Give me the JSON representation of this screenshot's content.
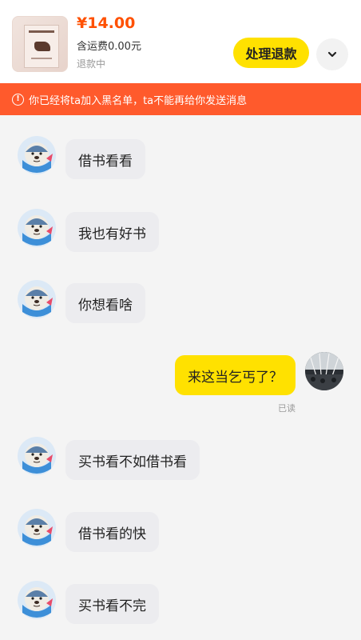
{
  "order": {
    "price": "¥14.00",
    "shipping": "含运费0.00元",
    "status": "退款中",
    "refund_button": "处理退款"
  },
  "banner": {
    "icon": "!",
    "text": "你已经将ta加入黑名单，ta不能再给你发送消息"
  },
  "messages": [
    {
      "side": "received",
      "text": "借书看看"
    },
    {
      "side": "received",
      "text": "我也有好书"
    },
    {
      "side": "received",
      "text": "你想看啥"
    },
    {
      "side": "sent",
      "text": "来这当乞丐了？",
      "status": "已读"
    },
    {
      "side": "received",
      "text": "买书看不如借书看"
    },
    {
      "side": "received",
      "text": "借书看的快"
    },
    {
      "side": "received",
      "text": "买书看不完"
    }
  ],
  "colors": {
    "accent_yellow": "#ffe100",
    "price_orange": "#ff5000",
    "banner_orange": "#ff5a2c",
    "received_bubble": "#ececef"
  },
  "icons": {
    "expand": "chevron-down-icon",
    "warning": "info-circle-icon",
    "contact_avatar": "seal-avatar",
    "user_avatar": "concert-photo-avatar"
  }
}
